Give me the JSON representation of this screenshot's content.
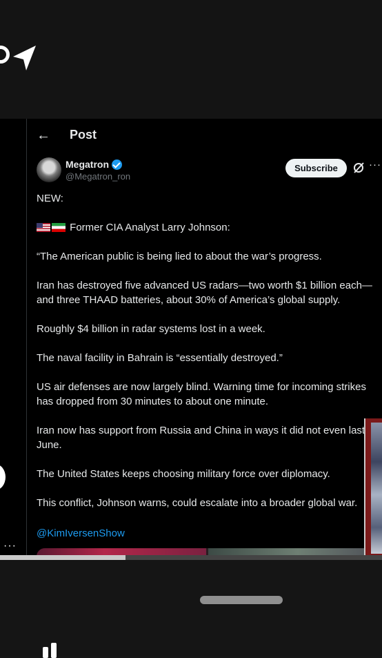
{
  "header": {
    "title": "Post"
  },
  "author": {
    "name": "Megatron",
    "handle": "@Megatron_ron"
  },
  "actions": {
    "subscribe_label": "Subscribe"
  },
  "post": {
    "lines": [
      "NEW:",
      "Former CIA Analyst Larry Johnson:",
      "“The American public is being lied to about the war’s progress.",
      "Iran has destroyed five advanced US radars—two worth $1 billion each—",
      "and three THAAD batteries, about 30% of America’s global supply.",
      "Roughly $4 billion in radar systems lost in a week.",
      "The naval facility in Bahrain is “essentially destroyed.”",
      "US air defenses are now largely blind. Warning time for incoming strikes",
      "has dropped from 30 minutes to about one minute.",
      "Iran now has support from Russia and China in ways it did not even last",
      "June.",
      "The United States keeps choosing military force over diplomacy.",
      "This conflict, Johnson warns, could escalate into a broader global war."
    ],
    "mention": "@KimIversenShow"
  },
  "colors": {
    "accent": "#1d9bf0",
    "background": "#000000",
    "text": "#e7e9ea",
    "muted": "#71767b"
  },
  "icons": [
    "navigation-arrow-icon",
    "back-arrow-icon",
    "verified-badge-icon",
    "grok-icon",
    "more-icon"
  ]
}
